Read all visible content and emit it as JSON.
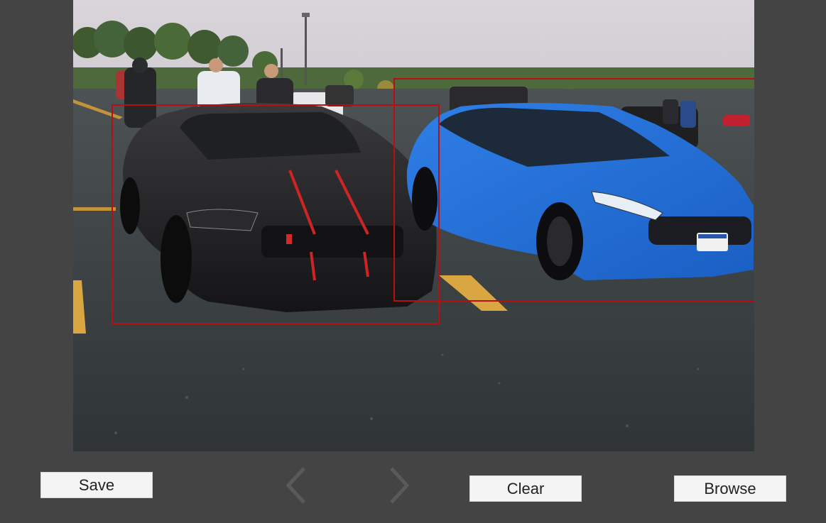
{
  "toolbar": {
    "save_label": "Save",
    "clear_label": "Clear",
    "browse_label": "Browse",
    "prev_icon": "chevron-left-icon",
    "next_icon": "chevron-right-icon"
  },
  "annotations": {
    "box_color": "#b80f0f",
    "boxes": [
      {
        "name": "black car"
      },
      {
        "name": "blue car"
      }
    ]
  },
  "colors": {
    "background": "#444444",
    "button": "#f4f4f4",
    "arrow": "#5a5a5a"
  }
}
